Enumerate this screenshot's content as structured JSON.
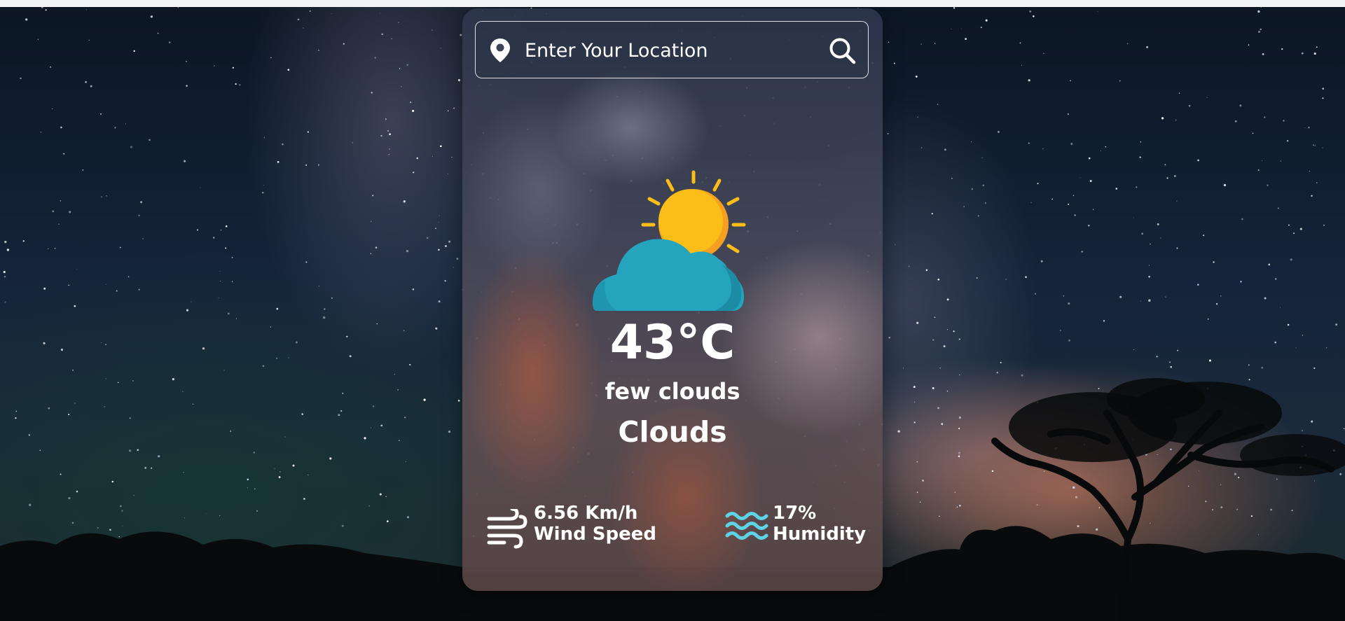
{
  "search": {
    "placeholder": "Enter Your Location",
    "value": ""
  },
  "weather": {
    "icon": "sun-behind-cloud-icon",
    "temperature": "43°C",
    "description": "few clouds",
    "main": "Clouds"
  },
  "stats": {
    "wind": {
      "value": "6.56 Km/h",
      "label": "Wind Speed",
      "icon": "wind-icon"
    },
    "humidity": {
      "value": "17%",
      "label": "Humidity",
      "icon": "waves-icon"
    }
  },
  "colors": {
    "sun": "#fbbd18",
    "sun_shade": "#f59f22",
    "cloud": "#25a4bd",
    "cloud_shade": "#1c8ca5",
    "humidity_icon": "#5fd3e6",
    "text": "#ffffff"
  }
}
